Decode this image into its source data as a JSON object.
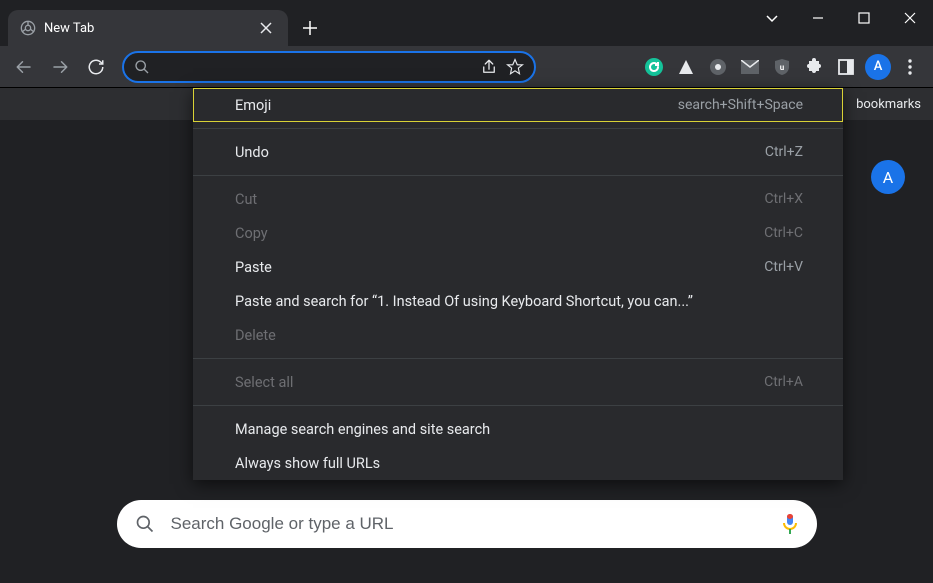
{
  "tab": {
    "title": "New Tab"
  },
  "bookmarks_bar": {
    "trailing_text": "bookmarks"
  },
  "avatar_letter": "A",
  "search": {
    "placeholder": "Search Google or type a URL"
  },
  "context_menu": {
    "items": [
      {
        "label": "Emoji",
        "accel": "search+Shift+Space",
        "disabled": false,
        "highlight": true
      },
      {
        "sep": true
      },
      {
        "label": "Undo",
        "accel": "Ctrl+Z",
        "disabled": false
      },
      {
        "sep": true
      },
      {
        "label": "Cut",
        "accel": "Ctrl+X",
        "disabled": true
      },
      {
        "label": "Copy",
        "accel": "Ctrl+C",
        "disabled": true
      },
      {
        "label": "Paste",
        "accel": "Ctrl+V",
        "disabled": false
      },
      {
        "label": "Paste and search for “1. Instead Of using Keyboard Shortcut, you can...”",
        "accel": "",
        "disabled": false
      },
      {
        "label": "Delete",
        "accel": "",
        "disabled": true
      },
      {
        "sep": true
      },
      {
        "label": "Select all",
        "accel": "Ctrl+A",
        "disabled": true
      },
      {
        "sep": true
      },
      {
        "label": "Manage search engines and site search",
        "accel": "",
        "disabled": false
      },
      {
        "label": "Always show full URLs",
        "accel": "",
        "disabled": false
      }
    ]
  }
}
